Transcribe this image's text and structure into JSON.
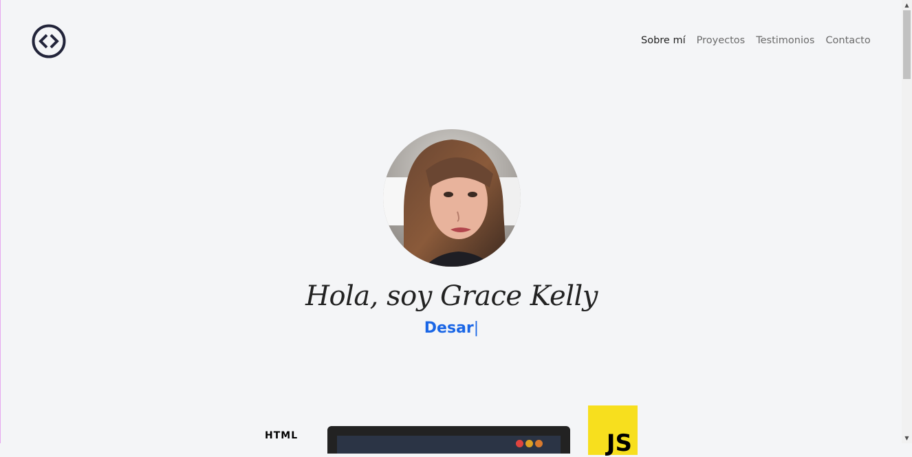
{
  "header": {
    "logo_icon": "code-brackets-icon",
    "nav": [
      {
        "label": "Sobre mí",
        "active": true
      },
      {
        "label": "Proyectos",
        "active": false
      },
      {
        "label": "Testimonios",
        "active": false
      },
      {
        "label": "Contacto",
        "active": false
      }
    ]
  },
  "hero": {
    "avatar_icon": "profile-photo",
    "greeting": "Hola, soy Grace Kelly",
    "typing_text": "Desar",
    "typing_caret": "|",
    "accent_color": "#1a66e6"
  },
  "skills": {
    "html_label": "HTML",
    "js_label": "JS",
    "laptop_icon": "laptop-icon",
    "js_color": "#f7df1e"
  },
  "scrollbar": {
    "up_icon": "scroll-up-arrow-icon",
    "down_icon": "scroll-down-arrow-icon"
  }
}
